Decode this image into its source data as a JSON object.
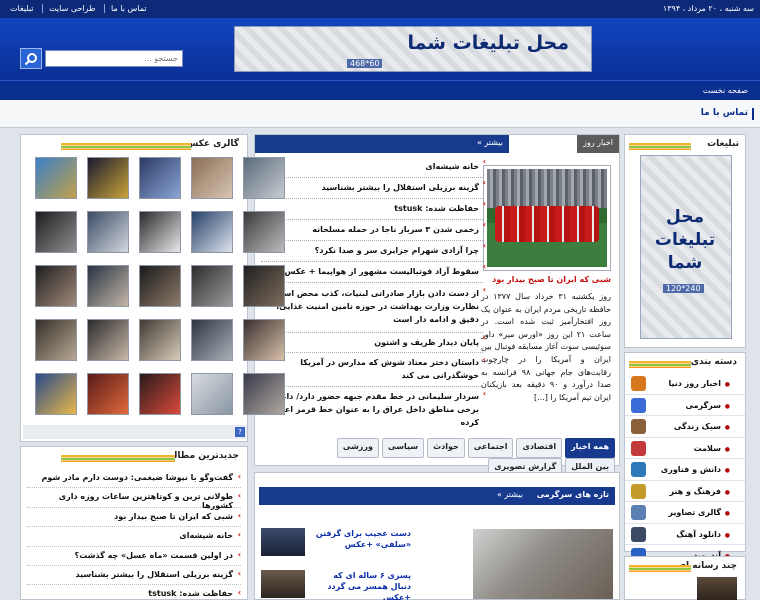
{
  "topbar": {
    "date": "سه شنبه ، ۲۰ مرداد ، ۱۳۹۴",
    "links": [
      "تماس با ما",
      "طراحی سایت",
      "تبلیغات"
    ]
  },
  "header": {
    "banner_text": "محل تبلیغات شما",
    "banner_size": "468*60",
    "search_placeholder": "جستجو ..."
  },
  "nav": {
    "home": "صفحه نخست"
  },
  "subnav": {
    "contact": "تماس با ما"
  },
  "ads": {
    "title": "تبلیغات",
    "box_text": "محل تبلیغات شما",
    "box_size": "120*240"
  },
  "categories": {
    "title": "دسته بندی",
    "items": [
      {
        "label": "اخبار روز دنیا",
        "color": "#d7781f"
      },
      {
        "label": "سرگرمی",
        "color": "#3a6bd6"
      },
      {
        "label": "سبک زندگی",
        "color": "#8a5f3a"
      },
      {
        "label": "سلامت",
        "color": "#c23a3a"
      },
      {
        "label": "دانش و فناوری",
        "color": "#2e7ab8"
      },
      {
        "label": "فرهنگ و هنر",
        "color": "#c49a2a"
      },
      {
        "label": "گالری تصاویر",
        "color": "#5a7fb3"
      },
      {
        "label": "دانلود آهنگ",
        "color": "#3c4a64"
      },
      {
        "label": "آندروید",
        "color": "#2a5fc4"
      }
    ]
  },
  "media": {
    "title": "چند رسانه ای"
  },
  "news": {
    "tab": "اخبار روز",
    "more": "بیشتر »",
    "lead_title": "شبی که ایران تا صبح بیدار بود",
    "lead_body": "روز یکشنبه ۳۱ خرداد سال ۱۳۷۷ در حافظه تاریخی مردم ایران به عنوان یک روز افتخارآمیز ثبت شده است. در ساعت ۲۱ این روز «اورس میر» داور سوئیسی سوت آغاز مسابقه فوتبال بین ایران و آمریکا را در چارچوب رقابت‌های جام جهانی ۹۸ فرانسه به صدا درآورد و ۹۰ دقیقه بعد بازیکنان ایران تیم آمریکا را [...]",
    "list": [
      "خانه شیشه‌ای",
      "گزینه برزیلی استقلال را بیشتر بشناسید",
      "حفاظت شده: tstusk",
      "زخمی شدن ۳ سرباز ناجا در حمله مسلحانه",
      "چرا آزادی شهرام جزایری سر و صدا نکرد؟",
      "سقوط آزاد فوتبالیست مشهور از هواپیما + عکس",
      "از دست دادن بازار صادراتی لبنیات، کذب محض است/ نظارت وزارت بهداشت در حوزه تامین امنیت غذایی، دقیق و ادامه دار است",
      "پایان دیدار ظریف و اشتون",
      "داستان دختر معتاد شوش که مدارس در آمریکا خوشگذرانی می کند",
      "سردار سلیمانی در خط مقدم جبهه حضور دارد/ داعش برخی مناطق داخل عراق را به عنوان خط قرمز اعلام کرده"
    ],
    "tabs": [
      "همه اخبار",
      "اقتصادی",
      "اجتماعی",
      "حوادث",
      "سیاسی",
      "ورزشی",
      "بین الملل",
      "گزارش تصویری"
    ]
  },
  "entertainment": {
    "tab": "تازه های سرگرمی",
    "more": "بیشتر »",
    "items": [
      "دست عجیب برای گرفتن «سلفی» +عکس",
      "پسری ۶ ساله ای که دنبال همسر می گردد +عکس"
    ]
  },
  "gallery": {
    "title": "گالری عکس",
    "help": "?",
    "thumbs": [
      {
        "c1": "#3b7fc7",
        "c2": "#c2a14a"
      },
      {
        "c1": "#1a1a2e",
        "c2": "#c9a33b"
      },
      {
        "c1": "#2c3a64",
        "c2": "#8aa5d6"
      },
      {
        "c1": "#8a6e5a",
        "c2": "#d9c6b0"
      },
      {
        "c1": "#5a6a7a",
        "c2": "#c7ccd2"
      },
      {
        "c1": "#1d1d1d",
        "c2": "#8f8f8f"
      },
      {
        "c1": "#3c4b63",
        "c2": "#d3d8e0"
      },
      {
        "c1": "#2a2a2a",
        "c2": "#e8e8e8"
      },
      {
        "c1": "#25406a",
        "c2": "#dde3ec"
      },
      {
        "c1": "#3a3a3a",
        "c2": "#bdbdbd"
      },
      {
        "c1": "#1f1f1f",
        "c2": "#a18a7a"
      },
      {
        "c1": "#283445",
        "c2": "#c3b6a6"
      },
      {
        "c1": "#1a1a1a",
        "c2": "#8e7b6b"
      },
      {
        "c1": "#2d2d2d",
        "c2": "#9c9c9c"
      },
      {
        "c1": "#202020",
        "c2": "#7d6d5d"
      },
      {
        "c1": "#34302a",
        "c2": "#b8a894"
      },
      {
        "c1": "#2b2b2b",
        "c2": "#c8b8a8"
      },
      {
        "c1": "#403a34",
        "c2": "#d8cbb8"
      },
      {
        "c1": "#2e3640",
        "c2": "#a8b0b8"
      },
      {
        "c1": "#3a3030",
        "c2": "#d7c0a8"
      },
      {
        "c1": "#2a4a8a",
        "c2": "#e8b84a"
      },
      {
        "c1": "#5a1a1a",
        "c2": "#e06a3a"
      },
      {
        "c1": "#2a1a1a",
        "c2": "#d84a3a"
      },
      {
        "c1": "#d8dce0",
        "c2": "#8a96a4"
      },
      {
        "c1": "#3a3a4a",
        "c2": "#b0a8a0"
      }
    ]
  },
  "latest": {
    "title": "جدیدترین مطالب",
    "items": [
      "گفت‌وگو با نیوشا ضیغمی: دوست دارم مادر شوم",
      "طولانی ترین و کوتاهترین ساعات روزه داری کشورها",
      "شبی که ایران تا صبح بیدار بود",
      "خانه شیشه‌ای",
      "در اولین قسمت «ماه عسل» چه گذشت؟",
      "گزینه برزیلی استقلال را بیشتر بشناسید",
      "حفاظت شده: tstusk"
    ]
  }
}
